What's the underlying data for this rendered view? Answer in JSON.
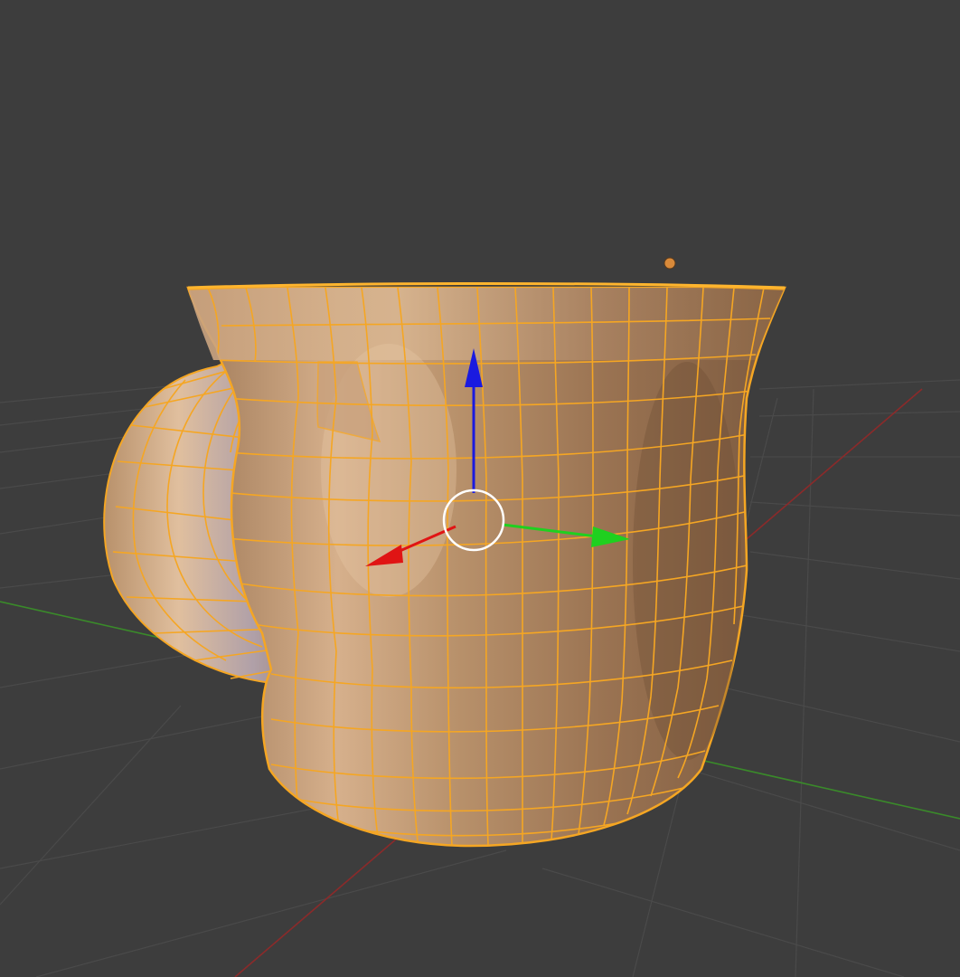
{
  "viewport": {
    "mode": "edit-mode",
    "background_color": "#3d3d3d",
    "grid_color": "#4a4a4a",
    "x_axis_color": "#8b2a2a",
    "y_axis_color": "#3a8a2a"
  },
  "object": {
    "type": "mug-mesh",
    "selected": true,
    "wire_color": "#f5a623",
    "surface_color": "#b8916b",
    "light_color": "#e0bf9e",
    "shadow_color": "#7c5a3f"
  },
  "gizmo": {
    "type": "translate-gizmo",
    "x_color": "#e01414",
    "y_color": "#1fd01f",
    "z_color": "#1a1ae0",
    "center_color": "#ffffff"
  },
  "light": {
    "type": "lamp-point",
    "color": "#d98a3a"
  }
}
